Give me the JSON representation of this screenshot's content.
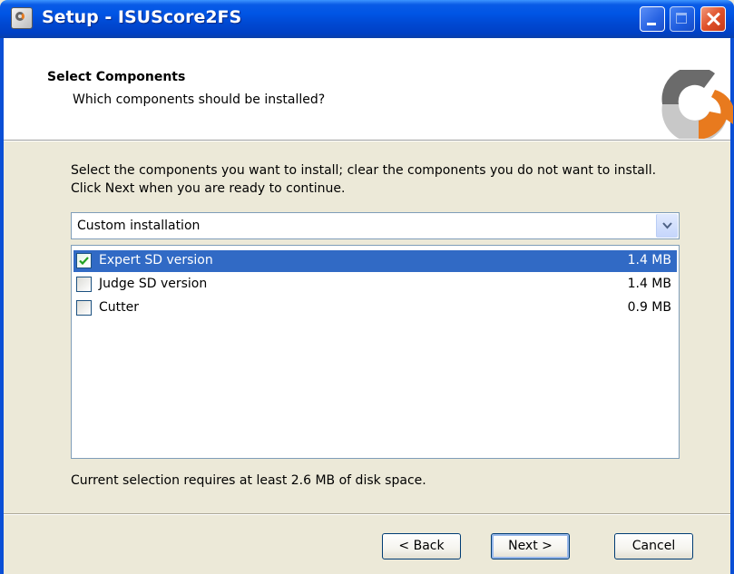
{
  "window": {
    "title": "Setup - ISUScore2FS"
  },
  "header": {
    "title": "Select Components",
    "subtitle": "Which components should be installed?"
  },
  "body": {
    "instructions": "Select the components you want to install; clear the components you do not want to install. Click Next when you are ready to continue.",
    "install_type": "Custom installation",
    "components": [
      {
        "label": "Expert SD version",
        "size": "1.4 MB",
        "checked": true,
        "selected": true
      },
      {
        "label": "Judge SD version",
        "size": "1.4 MB",
        "checked": false,
        "selected": false
      },
      {
        "label": "Cutter",
        "size": "0.9 MB",
        "checked": false,
        "selected": false
      }
    ],
    "disk_requirement": "Current selection requires at least 2.6 MB of disk space."
  },
  "buttons": {
    "back": "< Back",
    "next": "Next >",
    "cancel": "Cancel"
  },
  "colors": {
    "titlebar": "#0055e5",
    "selection": "#316ac5",
    "logo_orange": "#e87a1e",
    "logo_gray": "#6b6b6b"
  },
  "icons": {
    "app": "setup-app-icon",
    "logo": "isuscore-logo-icon",
    "check": "check-icon",
    "dropdown": "chevron-down-icon"
  }
}
